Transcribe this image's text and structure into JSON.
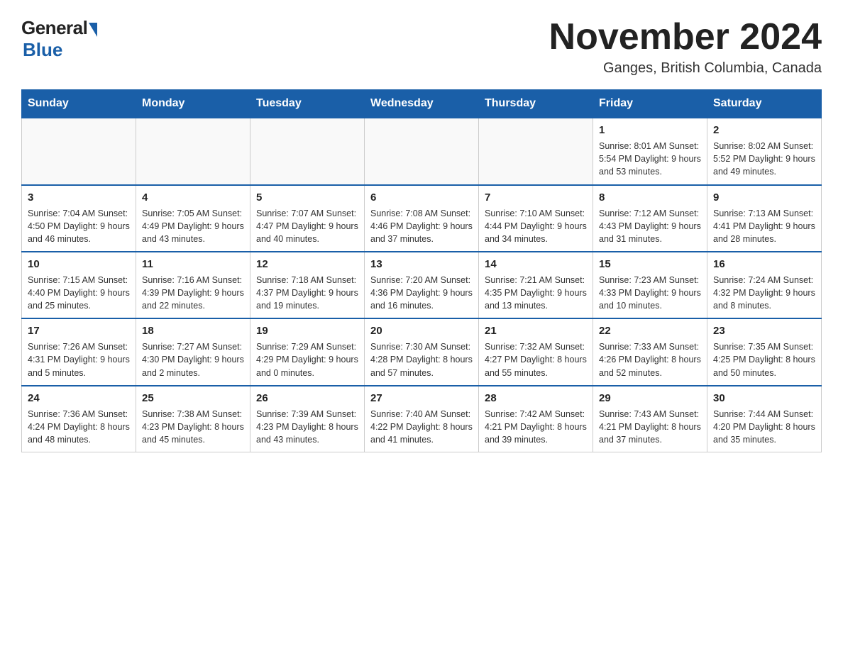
{
  "header": {
    "logo_general": "General",
    "logo_blue": "Blue",
    "month_title": "November 2024",
    "location": "Ganges, British Columbia, Canada"
  },
  "weekdays": [
    "Sunday",
    "Monday",
    "Tuesday",
    "Wednesday",
    "Thursday",
    "Friday",
    "Saturday"
  ],
  "weeks": [
    [
      {
        "day": "",
        "info": ""
      },
      {
        "day": "",
        "info": ""
      },
      {
        "day": "",
        "info": ""
      },
      {
        "day": "",
        "info": ""
      },
      {
        "day": "",
        "info": ""
      },
      {
        "day": "1",
        "info": "Sunrise: 8:01 AM\nSunset: 5:54 PM\nDaylight: 9 hours and 53 minutes."
      },
      {
        "day": "2",
        "info": "Sunrise: 8:02 AM\nSunset: 5:52 PM\nDaylight: 9 hours and 49 minutes."
      }
    ],
    [
      {
        "day": "3",
        "info": "Sunrise: 7:04 AM\nSunset: 4:50 PM\nDaylight: 9 hours and 46 minutes."
      },
      {
        "day": "4",
        "info": "Sunrise: 7:05 AM\nSunset: 4:49 PM\nDaylight: 9 hours and 43 minutes."
      },
      {
        "day": "5",
        "info": "Sunrise: 7:07 AM\nSunset: 4:47 PM\nDaylight: 9 hours and 40 minutes."
      },
      {
        "day": "6",
        "info": "Sunrise: 7:08 AM\nSunset: 4:46 PM\nDaylight: 9 hours and 37 minutes."
      },
      {
        "day": "7",
        "info": "Sunrise: 7:10 AM\nSunset: 4:44 PM\nDaylight: 9 hours and 34 minutes."
      },
      {
        "day": "8",
        "info": "Sunrise: 7:12 AM\nSunset: 4:43 PM\nDaylight: 9 hours and 31 minutes."
      },
      {
        "day": "9",
        "info": "Sunrise: 7:13 AM\nSunset: 4:41 PM\nDaylight: 9 hours and 28 minutes."
      }
    ],
    [
      {
        "day": "10",
        "info": "Sunrise: 7:15 AM\nSunset: 4:40 PM\nDaylight: 9 hours and 25 minutes."
      },
      {
        "day": "11",
        "info": "Sunrise: 7:16 AM\nSunset: 4:39 PM\nDaylight: 9 hours and 22 minutes."
      },
      {
        "day": "12",
        "info": "Sunrise: 7:18 AM\nSunset: 4:37 PM\nDaylight: 9 hours and 19 minutes."
      },
      {
        "day": "13",
        "info": "Sunrise: 7:20 AM\nSunset: 4:36 PM\nDaylight: 9 hours and 16 minutes."
      },
      {
        "day": "14",
        "info": "Sunrise: 7:21 AM\nSunset: 4:35 PM\nDaylight: 9 hours and 13 minutes."
      },
      {
        "day": "15",
        "info": "Sunrise: 7:23 AM\nSunset: 4:33 PM\nDaylight: 9 hours and 10 minutes."
      },
      {
        "day": "16",
        "info": "Sunrise: 7:24 AM\nSunset: 4:32 PM\nDaylight: 9 hours and 8 minutes."
      }
    ],
    [
      {
        "day": "17",
        "info": "Sunrise: 7:26 AM\nSunset: 4:31 PM\nDaylight: 9 hours and 5 minutes."
      },
      {
        "day": "18",
        "info": "Sunrise: 7:27 AM\nSunset: 4:30 PM\nDaylight: 9 hours and 2 minutes."
      },
      {
        "day": "19",
        "info": "Sunrise: 7:29 AM\nSunset: 4:29 PM\nDaylight: 9 hours and 0 minutes."
      },
      {
        "day": "20",
        "info": "Sunrise: 7:30 AM\nSunset: 4:28 PM\nDaylight: 8 hours and 57 minutes."
      },
      {
        "day": "21",
        "info": "Sunrise: 7:32 AM\nSunset: 4:27 PM\nDaylight: 8 hours and 55 minutes."
      },
      {
        "day": "22",
        "info": "Sunrise: 7:33 AM\nSunset: 4:26 PM\nDaylight: 8 hours and 52 minutes."
      },
      {
        "day": "23",
        "info": "Sunrise: 7:35 AM\nSunset: 4:25 PM\nDaylight: 8 hours and 50 minutes."
      }
    ],
    [
      {
        "day": "24",
        "info": "Sunrise: 7:36 AM\nSunset: 4:24 PM\nDaylight: 8 hours and 48 minutes."
      },
      {
        "day": "25",
        "info": "Sunrise: 7:38 AM\nSunset: 4:23 PM\nDaylight: 8 hours and 45 minutes."
      },
      {
        "day": "26",
        "info": "Sunrise: 7:39 AM\nSunset: 4:23 PM\nDaylight: 8 hours and 43 minutes."
      },
      {
        "day": "27",
        "info": "Sunrise: 7:40 AM\nSunset: 4:22 PM\nDaylight: 8 hours and 41 minutes."
      },
      {
        "day": "28",
        "info": "Sunrise: 7:42 AM\nSunset: 4:21 PM\nDaylight: 8 hours and 39 minutes."
      },
      {
        "day": "29",
        "info": "Sunrise: 7:43 AM\nSunset: 4:21 PM\nDaylight: 8 hours and 37 minutes."
      },
      {
        "day": "30",
        "info": "Sunrise: 7:44 AM\nSunset: 4:20 PM\nDaylight: 8 hours and 35 minutes."
      }
    ]
  ]
}
